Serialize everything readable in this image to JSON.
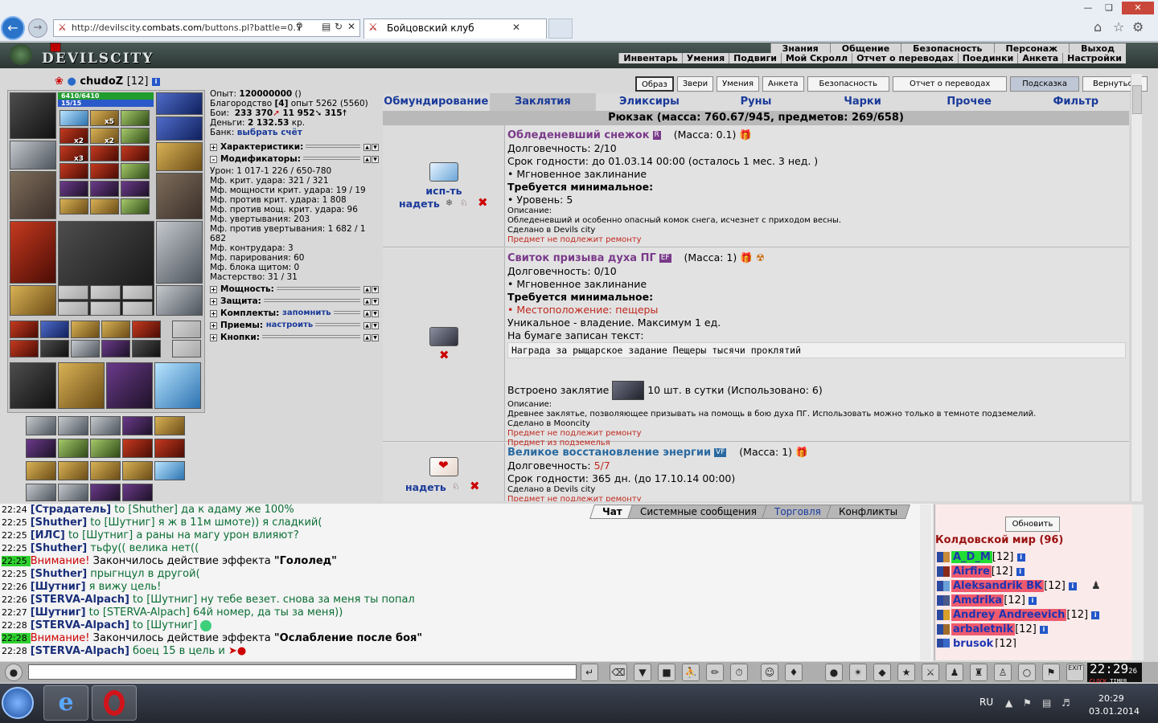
{
  "browser": {
    "url_prefix": "http://devilscity.",
    "url_domain": "combats.com",
    "url_suffix": "/buttons.pl?battle=0.7",
    "tab_title": "Бойцовский клуб"
  },
  "game_menu": {
    "top": [
      "Знания",
      "Общение",
      "Безопасность",
      "Персонаж",
      "Выход"
    ],
    "sub": [
      "Инвентарь",
      "Умения",
      "Подвиги",
      "Мой Скролл",
      "Отчет о переводах",
      "Поединки",
      "Анкета",
      "Настройки"
    ]
  },
  "logo": "DEVILSCITY",
  "character": {
    "nick": "chudoZ",
    "level": "[12]",
    "hp": "6410/6410",
    "mp": "15/15"
  },
  "stats": {
    "exp_label": "Опыт:",
    "exp_value": "120000000",
    "exp_extra": "()",
    "honor_label": "Благородство",
    "honor_lvl": "[4]",
    "honor_rest": "опыт 5262 (5560)",
    "fights_label": "Бои:",
    "fights_value": "233 370",
    "fights_lose": "11 952",
    "fights_draw": "315",
    "money_label": "Деньги:",
    "money_value": "2 132.53",
    "money_unit": "кр.",
    "bank_label": "Банк:",
    "bank_link": "выбрать счёт",
    "sec_characteristics": "Характеристики:",
    "sec_modifiers": "Модификаторы:",
    "modifiers": [
      "Урон: 1 017-1 226 / 650-780",
      "Мф. крит. удара: 321 / 321",
      "Мф. мощности крит. удара: 19 / 19",
      "Мф. против крит. удара: 1 808",
      "Мф. против мощ. крит. удара: 96",
      "Мф. увертывания: 203",
      "Мф. против увертывания: 1 682 / 1 682",
      "Мф. контрудара: 3",
      "Мф. парирования: 60",
      "Мф. блока щитом: 0",
      "Мастерство: 31 / 31"
    ],
    "sec_power": "Мощность:",
    "sec_defense": "Защита:",
    "sec_sets": "Комплекты:",
    "sets_link": "запомнить",
    "sec_tricks": "Приемы:",
    "tricks_link": "настроить",
    "sec_buttons": "Кнопки:"
  },
  "top_buttons": [
    "Образ",
    "Звери",
    "Умения",
    "Анкета",
    "Безопасность",
    "Отчет о переводах",
    "Подсказка",
    "Вернуться"
  ],
  "inventory": {
    "tabs": [
      "Обмундирование",
      "Заклятия",
      "Эликсиры",
      "Руны",
      "Чарки",
      "Прочее",
      "Фильтр"
    ],
    "header": "Рюкзак (масса: 760.67/945, предметов: 269/658)",
    "items": [
      {
        "use": "исп-ть",
        "wear": "надеть",
        "name": "Обледеневший снежок",
        "tag": "R",
        "mass": "(Масса: 0.1)",
        "lines": [
          "Долговечность: 2/10",
          "Срок годности: до 01.03.14 00:00 (осталось 1 мес. 3 нед. )",
          "• Мгновенное заклинание"
        ],
        "req_title": "Требуется минимальное:",
        "req": "• Уровень: 5",
        "desc_label": "Описание:",
        "desc": "Обледеневший и особенно опасный комок снега, исчезнет с приходом весны.",
        "made": "Сделано в Devils city",
        "norepair": "Предмет не подлежит ремонту"
      },
      {
        "name": "Свиток призыва духа ПГ",
        "tag": "EF",
        "mass": "(Масса: 1)",
        "lines": [
          "Долговечность: 0/10",
          "• Мгновенное заклинание"
        ],
        "req_title": "Требуется минимальное:",
        "req": "• Местоположение: пещеры",
        "unique": "Уникальное - владение. Максимум 1 ед.",
        "paper": "На бумаге записан текст:",
        "quote": "Награда за рыщарское задание Пещеры тысячи проклятий",
        "builtin_pre": "Встроено заклятие",
        "builtin_post": "10 шт. в сутки (Использовано: 6)",
        "desc_label": "Описание:",
        "desc": "Древнее заклятье, позволяющее призывать на помощь в бою духа ПГ. Использовать можно только в темноте подземелий.",
        "made": "Сделано в Mooncity",
        "norepair": "Предмет не подлежит ремонту",
        "from_dungeon": "Предмет из подземелья"
      },
      {
        "wear": "надеть",
        "name": "Великое восстановление энергии",
        "tag": "VF",
        "mass": "(Масса: 1)",
        "dur_label": "Долговечность:",
        "dur_value": "5/7",
        "lines": [
          "Срок годности: 365 дн. (до 17.10.14 00:00)",
          "Сделано в Devils city"
        ],
        "norepair": "Предмет не подлежит ремонту"
      }
    ]
  },
  "chat": {
    "tabs": [
      "Чат",
      "Системные сообщения",
      "Торговля",
      "Конфликты"
    ],
    "lines": [
      {
        "t": "22:24",
        "who": "[Страдатель]",
        "msg": " to [Shuther] да к адаму же 100%"
      },
      {
        "t": "22:25",
        "who": "[Shuther]",
        "msg": " to [Шутниг] я ж в 11м шмоте)) я сладкий("
      },
      {
        "t": "22:25",
        "who": "[ИЛС]",
        "msg": " to [Шутниг] а раны на магу урон влияют?"
      },
      {
        "t": "22:25",
        "who": "[Shuther]",
        "msg": " тьфу(( велика нет(("
      },
      {
        "t": "22:25",
        "sys": "Внимание!",
        "pre": " Закончилось действие эффекта ",
        "eff": "\"Гололед\""
      },
      {
        "t": "22:25",
        "who": "[Shuther]",
        "msg": " прыгнцул в другой("
      },
      {
        "t": "22:26",
        "who": "[Шутниг]",
        "msg": " я вижу цель!"
      },
      {
        "t": "22:26",
        "who": "[STERVA-Alpach]",
        "msg": " to [Шутниг] ну тебе везет. снова за меня ты попал"
      },
      {
        "t": "22:27",
        "who": "[Шутниг]",
        "msg": " to [STERVA-Alpach] 64й номер, да ты за меня))"
      },
      {
        "t": "22:28",
        "who": "[STERVA-Alpach]",
        "msg": " to [Шутниг]"
      },
      {
        "t": "22:28",
        "sys": "Внимание!",
        "pre": " Закончилось действие эффекта ",
        "eff": "\"Ослабление после боя\""
      },
      {
        "t": "22:28",
        "who": "[STERVA-Alpach]",
        "msg": " боец 15 в цель и"
      }
    ]
  },
  "online": {
    "refresh": "Обновить",
    "world": "Колдовской мир (96)",
    "players": [
      {
        "name": "A_D_M",
        "lvl": "[12]",
        "style": "gr"
      },
      {
        "name": "Airfire",
        "lvl": "[12]",
        "style": "pk"
      },
      {
        "name": "Aleksandrik BK",
        "lvl": "[12]",
        "style": "pk"
      },
      {
        "name": "Amdrika",
        "lvl": "[12]",
        "style": "pk"
      },
      {
        "name": "Andrey Andreevich",
        "lvl": "[12]",
        "style": "pk"
      },
      {
        "name": "arbaletnik",
        "lvl": "[12]",
        "style": "pk"
      },
      {
        "name": "brusok",
        "lvl": "[12]",
        "style": ""
      }
    ]
  },
  "clock": {
    "time": "22:29",
    "sec": "26",
    "label1": "CLOCK",
    "label2": "TIMER"
  },
  "taskbar": {
    "lang": "RU",
    "time": "20:29",
    "date": "03.01.2014"
  }
}
